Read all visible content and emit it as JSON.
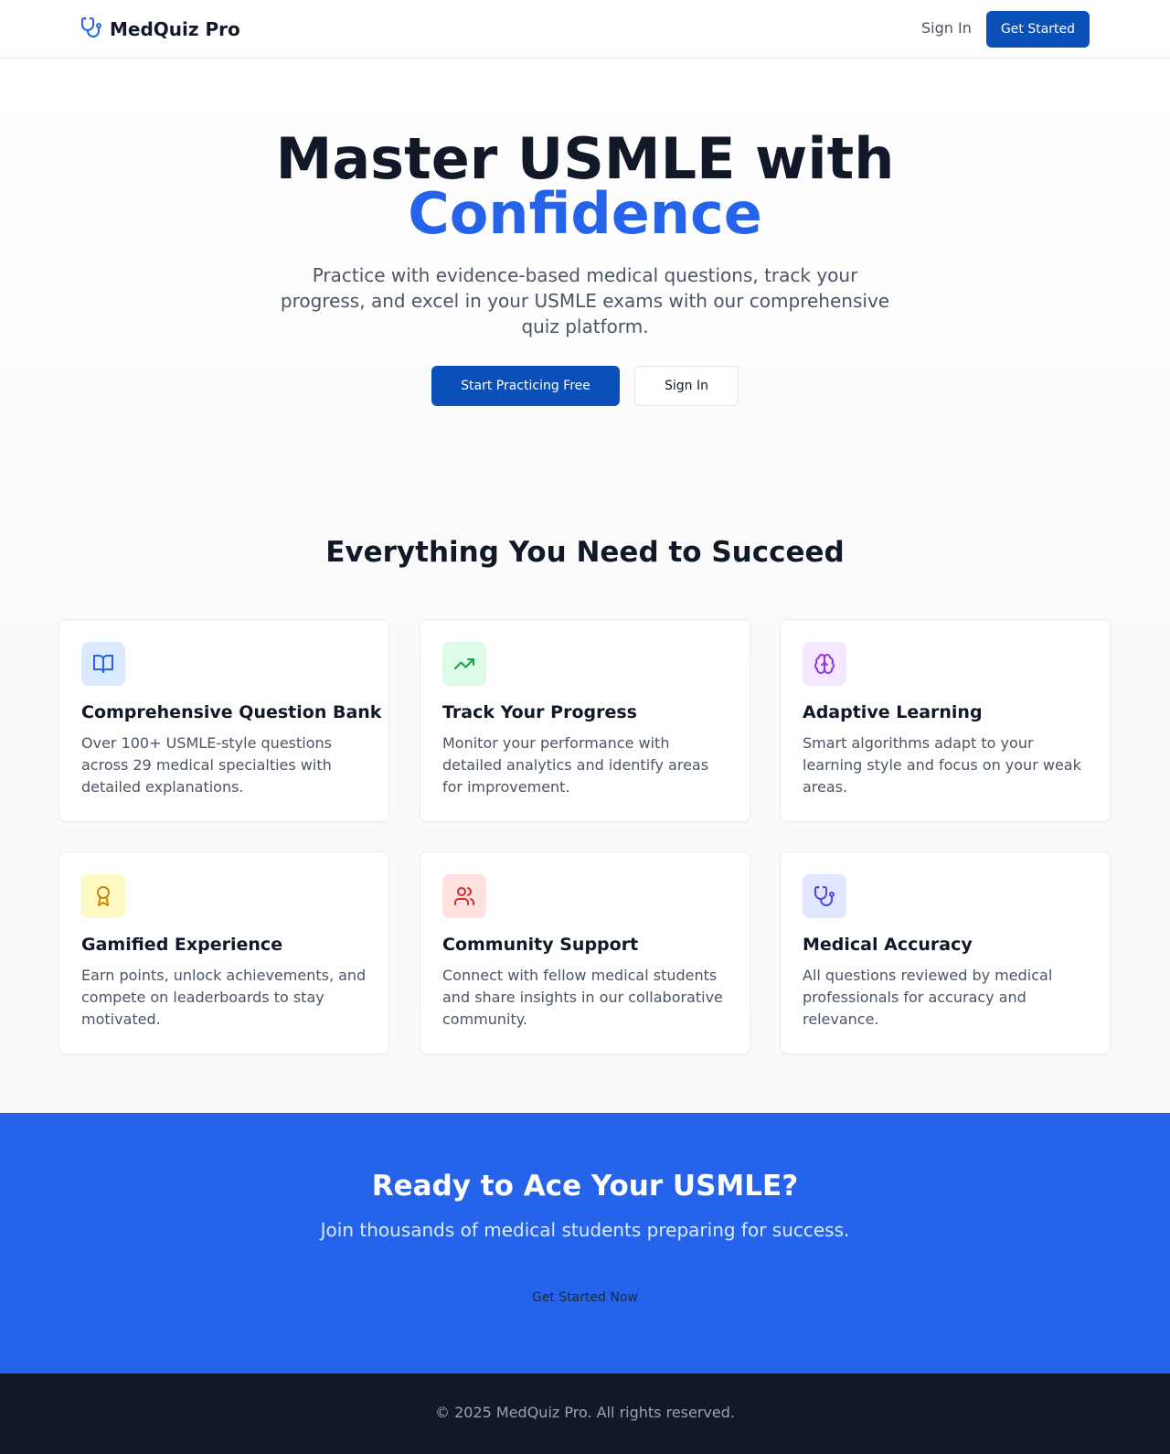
{
  "nav": {
    "brand": "MedQuiz Pro",
    "brand_icon": "stethoscope-icon",
    "sign_in": "Sign In",
    "get_started": "Get Started"
  },
  "hero": {
    "title_line1": "Master USMLE with",
    "title_accent": "Confidence",
    "subtitle": "Practice with evidence-based medical questions, track your progress, and excel in your USMLE exams with our comprehensive quiz platform.",
    "primary_button": "Start Practicing Free",
    "secondary_button": "Sign In"
  },
  "features": {
    "title": "Everything You Need to Succeed",
    "items": [
      {
        "title": "Comprehensive Question Bank",
        "description": "Over 100+ USMLE-style questions across 29 medical specialties with detailed explanations.",
        "icon": "book-open-icon",
        "icon_bg": "#dbeafe",
        "icon_color": "#2563eb"
      },
      {
        "title": "Track Your Progress",
        "description": "Monitor your performance with detailed analytics and identify areas for improvement.",
        "icon": "trending-up-icon",
        "icon_bg": "#dcfce7",
        "icon_color": "#16a34a"
      },
      {
        "title": "Adaptive Learning",
        "description": "Smart algorithms adapt to your learning style and focus on your weak areas.",
        "icon": "brain-icon",
        "icon_bg": "#f3e8ff",
        "icon_color": "#9333ea"
      },
      {
        "title": "Gamified Experience",
        "description": "Earn points, unlock achievements, and compete on leaderboards to stay motivated.",
        "icon": "award-icon",
        "icon_bg": "#fef9c3",
        "icon_color": "#ca8a04"
      },
      {
        "title": "Community Support",
        "description": "Connect with fellow medical students and share insights in our collaborative community.",
        "icon": "users-icon",
        "icon_bg": "#fee2e2",
        "icon_color": "#dc2626"
      },
      {
        "title": "Medical Accuracy",
        "description": "All questions reviewed by medical professionals for accuracy and relevance.",
        "icon": "stethoscope-icon",
        "icon_bg": "#e0e7ff",
        "icon_color": "#4f46e5"
      }
    ]
  },
  "cta": {
    "title": "Ready to Ace Your USMLE?",
    "subtitle": "Join thousands of medical students preparing for success.",
    "button": "Get Started Now"
  },
  "footer": {
    "copyright": "© 2025 MedQuiz Pro. All rights reserved."
  },
  "colors": {
    "primary": "#2563eb",
    "button": "#0b4fb8",
    "footer_bg": "#111827"
  }
}
